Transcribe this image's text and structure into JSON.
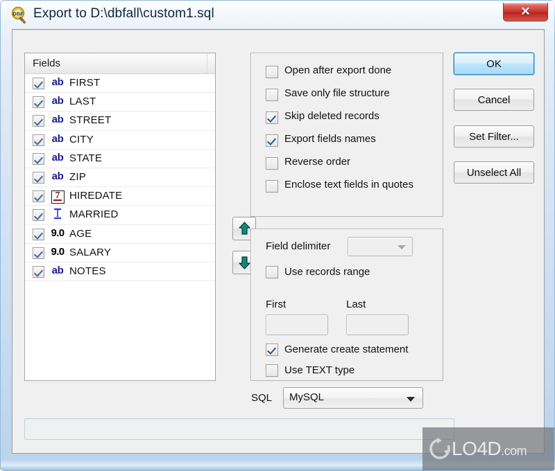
{
  "window": {
    "title": "Export to D:\\dbfall\\custom1.sql",
    "app_icon": "dbf-magnifier-icon",
    "close_label": "✕"
  },
  "fields_panel": {
    "header": "Fields",
    "rows": [
      {
        "checked": true,
        "type": "ab",
        "name": "FIRST"
      },
      {
        "checked": true,
        "type": "ab",
        "name": "LAST"
      },
      {
        "checked": true,
        "type": "ab",
        "name": "STREET"
      },
      {
        "checked": true,
        "type": "ab",
        "name": "CITY"
      },
      {
        "checked": true,
        "type": "ab",
        "name": "STATE"
      },
      {
        "checked": true,
        "type": "ab",
        "name": "ZIP"
      },
      {
        "checked": true,
        "type": "date",
        "name": "HIREDATE"
      },
      {
        "checked": true,
        "type": "logical",
        "name": "MARRIED"
      },
      {
        "checked": true,
        "type": "9.0",
        "name": "AGE"
      },
      {
        "checked": true,
        "type": "9.0",
        "name": "SALARY"
      },
      {
        "checked": true,
        "type": "ab",
        "name": "NOTES"
      }
    ],
    "type_glyphs": {
      "ab": "ab",
      "9.0": "9.0",
      "logical": "I",
      "date": "7"
    }
  },
  "move_buttons": {
    "up": "move-field-up",
    "down": "move-field-down"
  },
  "options_group": {
    "items": [
      {
        "label": "Open after export done",
        "checked": false
      },
      {
        "label": "Save only file structure",
        "checked": false
      },
      {
        "label": "Skip deleted records",
        "checked": true
      },
      {
        "label": "Export fields names",
        "checked": true
      },
      {
        "label": "Reverse order",
        "checked": false
      },
      {
        "label": "Enclose text fields in quotes",
        "checked": false
      }
    ]
  },
  "sql_group": {
    "field_delimiter_label": "Field delimiter",
    "field_delimiter_value": "",
    "use_records_range": {
      "label": "Use records range",
      "checked": false
    },
    "first_label": "First",
    "first_value": "",
    "last_label": "Last",
    "last_value": "",
    "generate_create": {
      "label": "Generate create statement",
      "checked": true
    },
    "use_text_type": {
      "label": "Use TEXT type",
      "checked": false
    }
  },
  "buttons": {
    "ok": "OK",
    "cancel": "Cancel",
    "set_filter": "Set Filter...",
    "unselect_all": "Unselect All"
  },
  "sql_selector": {
    "label": "SQL",
    "value": "MySQL"
  },
  "status_bar": {
    "text": ""
  },
  "watermark": {
    "name": "LO4D",
    "suffix": ".com"
  },
  "colors": {
    "accent": "#3c7fb1",
    "close_red": "#c8332c",
    "field_char_type": "#1a1a8c",
    "field_date_type": "#8d1515",
    "field_logical_type": "#2a2ad0",
    "arrow_teal": "#0b8a7d"
  }
}
